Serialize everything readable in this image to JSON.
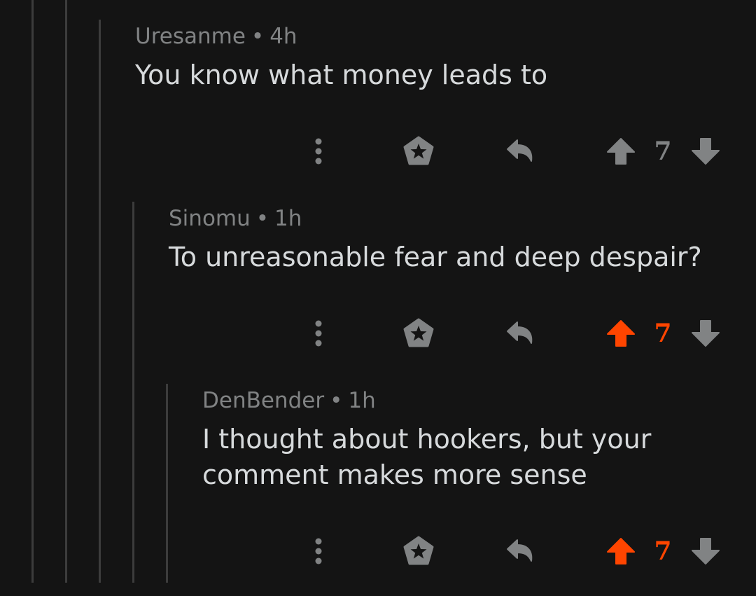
{
  "colors": {
    "background": "#141414",
    "thread_line": "#3c3c3c",
    "meta_text": "#818384",
    "body_text": "#d7dadc",
    "icon": "#818384",
    "upvote_active": "#ff4500"
  },
  "comments": [
    {
      "author": "Uresanme",
      "separator": "•",
      "age": "4h",
      "body": "You know what money leads to",
      "score": "7",
      "upvoted": false,
      "icons": [
        "more-options-icon",
        "award-icon",
        "reply-icon",
        "upvote-arrow-icon",
        "downvote-arrow-icon"
      ]
    },
    {
      "author": "Sinomu",
      "separator": "•",
      "age": "1h",
      "body": "To unreasonable fear and deep despair?",
      "score": "7",
      "upvoted": true,
      "icons": [
        "more-options-icon",
        "award-icon",
        "reply-icon",
        "upvote-arrow-icon",
        "downvote-arrow-icon"
      ]
    },
    {
      "author": "DenBender",
      "separator": "•",
      "age": "1h",
      "body": "I thought about hookers, but your\ncomment makes more sense",
      "score": "7",
      "upvoted": true,
      "icons": [
        "more-options-icon",
        "award-icon",
        "reply-icon",
        "upvote-arrow-icon",
        "downvote-arrow-icon"
      ]
    }
  ]
}
